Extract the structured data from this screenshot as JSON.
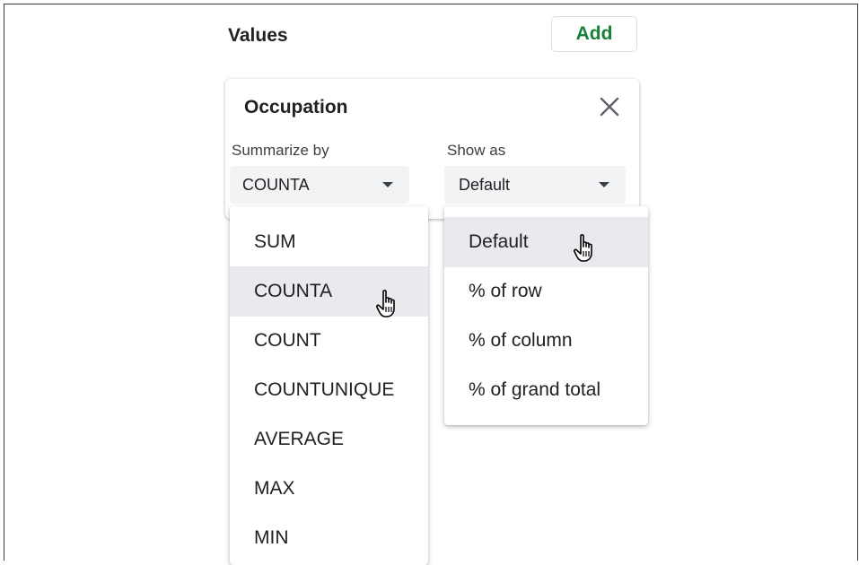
{
  "values_section": {
    "label": "Values",
    "add_label": "Add"
  },
  "value_card": {
    "title": "Occupation",
    "summarize_by": {
      "label": "Summarize by",
      "selected": "COUNTA",
      "options": [
        "SUM",
        "COUNTA",
        "COUNT",
        "COUNTUNIQUE",
        "AVERAGE",
        "MAX",
        "MIN"
      ],
      "hovered": "COUNTA"
    },
    "show_as": {
      "label": "Show as",
      "selected": "Default",
      "options": [
        "Default",
        "% of row",
        "% of column",
        "% of grand total"
      ],
      "hovered": "Default"
    }
  },
  "colors": {
    "accent_green": "#188038",
    "highlight": "#e8eaed",
    "select_bg": "#f1f3f4"
  },
  "icons": {
    "close": "close-icon",
    "caret": "chevron-down-icon",
    "cursor": "hand-pointer-icon"
  }
}
